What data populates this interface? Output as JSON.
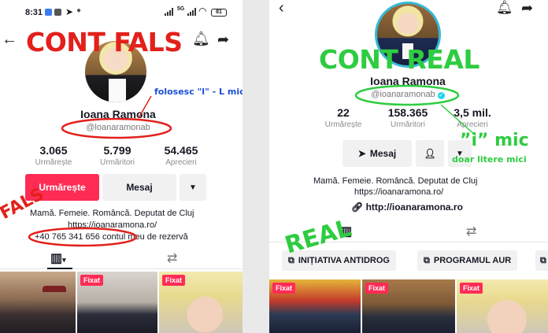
{
  "left": {
    "status": {
      "time": "8:31",
      "battery": "81"
    },
    "overlay_title": "CONT FALS",
    "annotation_l": "folosesc \"l\" - L mic",
    "diagonal_label": "FALS",
    "profile": {
      "name": "Ioana Ramona",
      "handle": "@loanaramonab"
    },
    "stats": [
      {
        "value": "3.065",
        "label": "Urmărește"
      },
      {
        "value": "5.799",
        "label": "Urmăritori"
      },
      {
        "value": "54.465",
        "label": "Aprecieri"
      }
    ],
    "buttons": {
      "follow": "Urmărește",
      "message": "Mesaj"
    },
    "bio": {
      "line1": "Mamă. Femeie. Româncă. Deputat de Cluj",
      "line2": "https://ioanaramona.ro/",
      "line3": "+40 765 341 656 contul meu de rezervă"
    },
    "thumbs": [
      {
        "pin": ""
      },
      {
        "pin": "Fixat"
      },
      {
        "pin": "Fixat"
      }
    ],
    "colors": {
      "accent": "#fe2c55",
      "annotation": "#e3201b"
    }
  },
  "right": {
    "overlay_title": "CONT REAL",
    "annotation_i": "”i” mic",
    "annotation_lower": "doar litere mici",
    "diagonal_label": "REAL",
    "profile": {
      "name": "Ioana Ramona",
      "handle": "@ioanaramonab"
    },
    "stats": [
      {
        "value": "22",
        "label": "Urmărește"
      },
      {
        "value": "158.365",
        "label": "Urmăritori"
      },
      {
        "value": "3,5 mil.",
        "label": "Aprecieri"
      }
    ],
    "buttons": {
      "message": "Mesaj"
    },
    "bio": {
      "line1": "Mamă. Femeie. Româncă. Deputat de Cluj",
      "line2": "https://ioanaramona.ro/",
      "link": "http://ioanaramona.ro"
    },
    "playlists": [
      {
        "label": "INIȚIATIVA ANTIDROG"
      },
      {
        "label": "PROGRAMUL AUR"
      }
    ],
    "thumbs": [
      {
        "pin": "Fixat"
      },
      {
        "pin": "Fixat"
      },
      {
        "pin": "Fixat"
      }
    ],
    "colors": {
      "annotation": "#2ecc40",
      "verified": "#20d5ec"
    }
  }
}
